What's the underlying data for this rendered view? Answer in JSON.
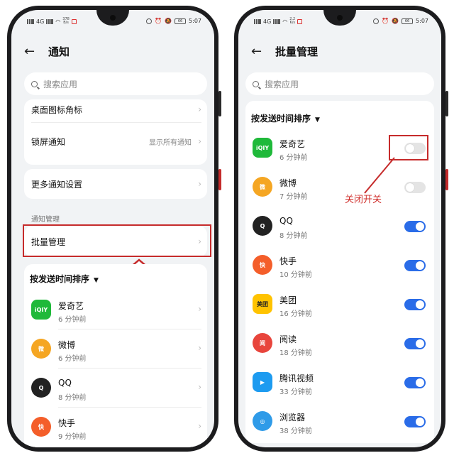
{
  "colors": {
    "accent": "#2a6ce8",
    "highlight": "#c62b2b",
    "annotation": "#d0302d"
  },
  "left_screen": {
    "status": {
      "speed_top": "378",
      "speed_unit": "B/s",
      "net": "4G",
      "time": "5:07",
      "battery": "66"
    },
    "title": "通知",
    "search_placeholder": "搜索应用",
    "settings": [
      {
        "label": "桌面图标角标",
        "value": ""
      },
      {
        "label": "锁屏通知",
        "value": "显示所有通知"
      }
    ],
    "more_settings": "更多通知设置",
    "section_label": "通知管理",
    "batch_manage": "批量管理",
    "sort_label": "按发送时间排序",
    "apps": [
      {
        "name": "爱奇艺",
        "time": "6 分钟前",
        "icon": "iqiyi-icon",
        "color": "#1fb93a",
        "glyph": "iQIY"
      },
      {
        "name": "微博",
        "time": "6 分钟前",
        "icon": "weibo-icon",
        "color": "#f5a623",
        "glyph": "微"
      },
      {
        "name": "QQ",
        "time": "8 分钟前",
        "icon": "qq-penguin-icon",
        "color": "#222222",
        "glyph": "Q"
      },
      {
        "name": "快手",
        "time": "9 分钟前",
        "icon": "kuaishou-icon",
        "color": "#f45e2a",
        "glyph": "快"
      }
    ]
  },
  "right_screen": {
    "status": {
      "speed_top": "2.2",
      "speed_unit": "K/s",
      "net": "4G",
      "time": "5:07",
      "battery": "66"
    },
    "title": "批量管理",
    "search_placeholder": "搜索应用",
    "sort_label": "按发送时间排序",
    "annotation": "关闭开关",
    "apps": [
      {
        "name": "爱奇艺",
        "time": "6 分钟前",
        "icon": "iqiyi-icon",
        "color": "#1fb93a",
        "glyph": "iQIY",
        "enabled": false
      },
      {
        "name": "微博",
        "time": "7 分钟前",
        "icon": "weibo-icon",
        "color": "#f5a623",
        "glyph": "微",
        "enabled": false
      },
      {
        "name": "QQ",
        "time": "8 分钟前",
        "icon": "qq-penguin-icon",
        "color": "#222222",
        "glyph": "Q",
        "enabled": true
      },
      {
        "name": "快手",
        "time": "10 分钟前",
        "icon": "kuaishou-icon",
        "color": "#f45e2a",
        "glyph": "快",
        "enabled": true
      },
      {
        "name": "美团",
        "time": "16 分钟前",
        "icon": "meituan-icon",
        "color": "#ffc300",
        "glyph": "美团",
        "enabled": true
      },
      {
        "name": "阅读",
        "time": "18 分钟前",
        "icon": "reader-icon",
        "color": "#e8453c",
        "glyph": "阅",
        "enabled": true
      },
      {
        "name": "腾讯视频",
        "time": "33 分钟前",
        "icon": "tencent-video-icon",
        "color": "#1d9bf0",
        "glyph": "▶",
        "enabled": true
      },
      {
        "name": "浏览器",
        "time": "38 分钟前",
        "icon": "browser-icon",
        "color": "#2f9be8",
        "glyph": "◎",
        "enabled": true
      }
    ]
  }
}
